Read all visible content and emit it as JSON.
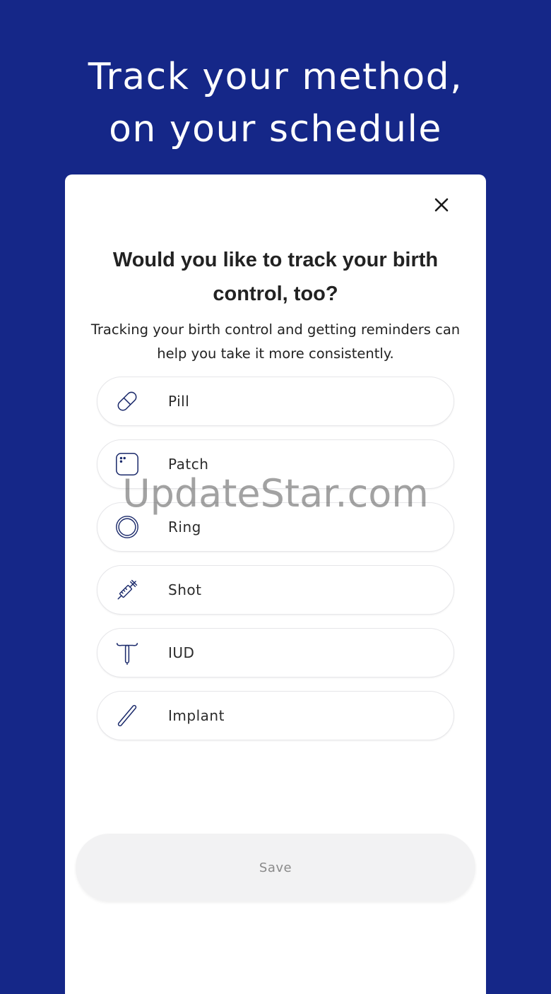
{
  "header": {
    "line1": "Track your method,",
    "line2": "on your schedule"
  },
  "modal": {
    "close_icon": "close-icon",
    "title": "Would you like to track your birth control, too?",
    "subtitle": "Tracking your birth control and getting reminders can help you take it more consistently.",
    "options": [
      {
        "label": "Pill",
        "icon": "pill-icon"
      },
      {
        "label": "Patch",
        "icon": "patch-icon"
      },
      {
        "label": "Ring",
        "icon": "ring-icon"
      },
      {
        "label": "Shot",
        "icon": "syringe-icon"
      },
      {
        "label": "IUD",
        "icon": "iud-icon"
      },
      {
        "label": "Implant",
        "icon": "implant-icon"
      }
    ],
    "save_label": "Save"
  },
  "watermark": "UpdateStar.com",
  "colors": {
    "background": "#152788",
    "icon_stroke": "#1b2a6b",
    "sheet": "#ffffff",
    "save_button_bg": "#f2f2f3",
    "save_button_text": "#8a8a8a"
  }
}
